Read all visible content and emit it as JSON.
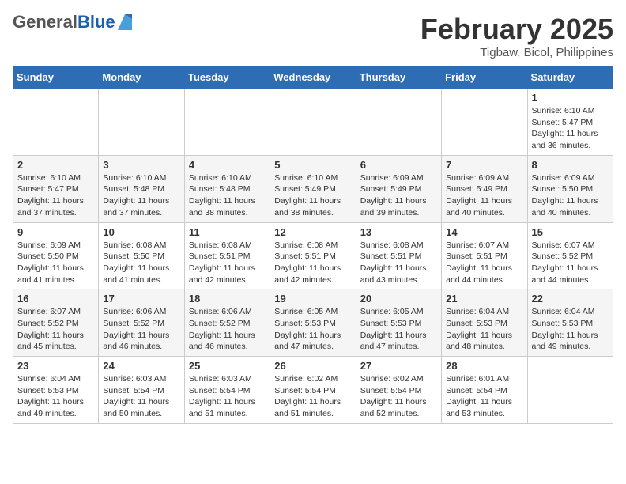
{
  "header": {
    "logo_general": "General",
    "logo_blue": "Blue",
    "month_title": "February 2025",
    "location": "Tigbaw, Bicol, Philippines"
  },
  "days_of_week": [
    "Sunday",
    "Monday",
    "Tuesday",
    "Wednesday",
    "Thursday",
    "Friday",
    "Saturday"
  ],
  "weeks": [
    [
      {
        "day": "",
        "info": ""
      },
      {
        "day": "",
        "info": ""
      },
      {
        "day": "",
        "info": ""
      },
      {
        "day": "",
        "info": ""
      },
      {
        "day": "",
        "info": ""
      },
      {
        "day": "",
        "info": ""
      },
      {
        "day": "1",
        "info": "Sunrise: 6:10 AM\nSunset: 5:47 PM\nDaylight: 11 hours\nand 36 minutes."
      }
    ],
    [
      {
        "day": "2",
        "info": "Sunrise: 6:10 AM\nSunset: 5:47 PM\nDaylight: 11 hours\nand 37 minutes."
      },
      {
        "day": "3",
        "info": "Sunrise: 6:10 AM\nSunset: 5:48 PM\nDaylight: 11 hours\nand 37 minutes."
      },
      {
        "day": "4",
        "info": "Sunrise: 6:10 AM\nSunset: 5:48 PM\nDaylight: 11 hours\nand 38 minutes."
      },
      {
        "day": "5",
        "info": "Sunrise: 6:10 AM\nSunset: 5:49 PM\nDaylight: 11 hours\nand 38 minutes."
      },
      {
        "day": "6",
        "info": "Sunrise: 6:09 AM\nSunset: 5:49 PM\nDaylight: 11 hours\nand 39 minutes."
      },
      {
        "day": "7",
        "info": "Sunrise: 6:09 AM\nSunset: 5:49 PM\nDaylight: 11 hours\nand 40 minutes."
      },
      {
        "day": "8",
        "info": "Sunrise: 6:09 AM\nSunset: 5:50 PM\nDaylight: 11 hours\nand 40 minutes."
      }
    ],
    [
      {
        "day": "9",
        "info": "Sunrise: 6:09 AM\nSunset: 5:50 PM\nDaylight: 11 hours\nand 41 minutes."
      },
      {
        "day": "10",
        "info": "Sunrise: 6:08 AM\nSunset: 5:50 PM\nDaylight: 11 hours\nand 41 minutes."
      },
      {
        "day": "11",
        "info": "Sunrise: 6:08 AM\nSunset: 5:51 PM\nDaylight: 11 hours\nand 42 minutes."
      },
      {
        "day": "12",
        "info": "Sunrise: 6:08 AM\nSunset: 5:51 PM\nDaylight: 11 hours\nand 42 minutes."
      },
      {
        "day": "13",
        "info": "Sunrise: 6:08 AM\nSunset: 5:51 PM\nDaylight: 11 hours\nand 43 minutes."
      },
      {
        "day": "14",
        "info": "Sunrise: 6:07 AM\nSunset: 5:51 PM\nDaylight: 11 hours\nand 44 minutes."
      },
      {
        "day": "15",
        "info": "Sunrise: 6:07 AM\nSunset: 5:52 PM\nDaylight: 11 hours\nand 44 minutes."
      }
    ],
    [
      {
        "day": "16",
        "info": "Sunrise: 6:07 AM\nSunset: 5:52 PM\nDaylight: 11 hours\nand 45 minutes."
      },
      {
        "day": "17",
        "info": "Sunrise: 6:06 AM\nSunset: 5:52 PM\nDaylight: 11 hours\nand 46 minutes."
      },
      {
        "day": "18",
        "info": "Sunrise: 6:06 AM\nSunset: 5:52 PM\nDaylight: 11 hours\nand 46 minutes."
      },
      {
        "day": "19",
        "info": "Sunrise: 6:05 AM\nSunset: 5:53 PM\nDaylight: 11 hours\nand 47 minutes."
      },
      {
        "day": "20",
        "info": "Sunrise: 6:05 AM\nSunset: 5:53 PM\nDaylight: 11 hours\nand 47 minutes."
      },
      {
        "day": "21",
        "info": "Sunrise: 6:04 AM\nSunset: 5:53 PM\nDaylight: 11 hours\nand 48 minutes."
      },
      {
        "day": "22",
        "info": "Sunrise: 6:04 AM\nSunset: 5:53 PM\nDaylight: 11 hours\nand 49 minutes."
      }
    ],
    [
      {
        "day": "23",
        "info": "Sunrise: 6:04 AM\nSunset: 5:53 PM\nDaylight: 11 hours\nand 49 minutes."
      },
      {
        "day": "24",
        "info": "Sunrise: 6:03 AM\nSunset: 5:54 PM\nDaylight: 11 hours\nand 50 minutes."
      },
      {
        "day": "25",
        "info": "Sunrise: 6:03 AM\nSunset: 5:54 PM\nDaylight: 11 hours\nand 51 minutes."
      },
      {
        "day": "26",
        "info": "Sunrise: 6:02 AM\nSunset: 5:54 PM\nDaylight: 11 hours\nand 51 minutes."
      },
      {
        "day": "27",
        "info": "Sunrise: 6:02 AM\nSunset: 5:54 PM\nDaylight: 11 hours\nand 52 minutes."
      },
      {
        "day": "28",
        "info": "Sunrise: 6:01 AM\nSunset: 5:54 PM\nDaylight: 11 hours\nand 53 minutes."
      },
      {
        "day": "",
        "info": ""
      }
    ]
  ]
}
